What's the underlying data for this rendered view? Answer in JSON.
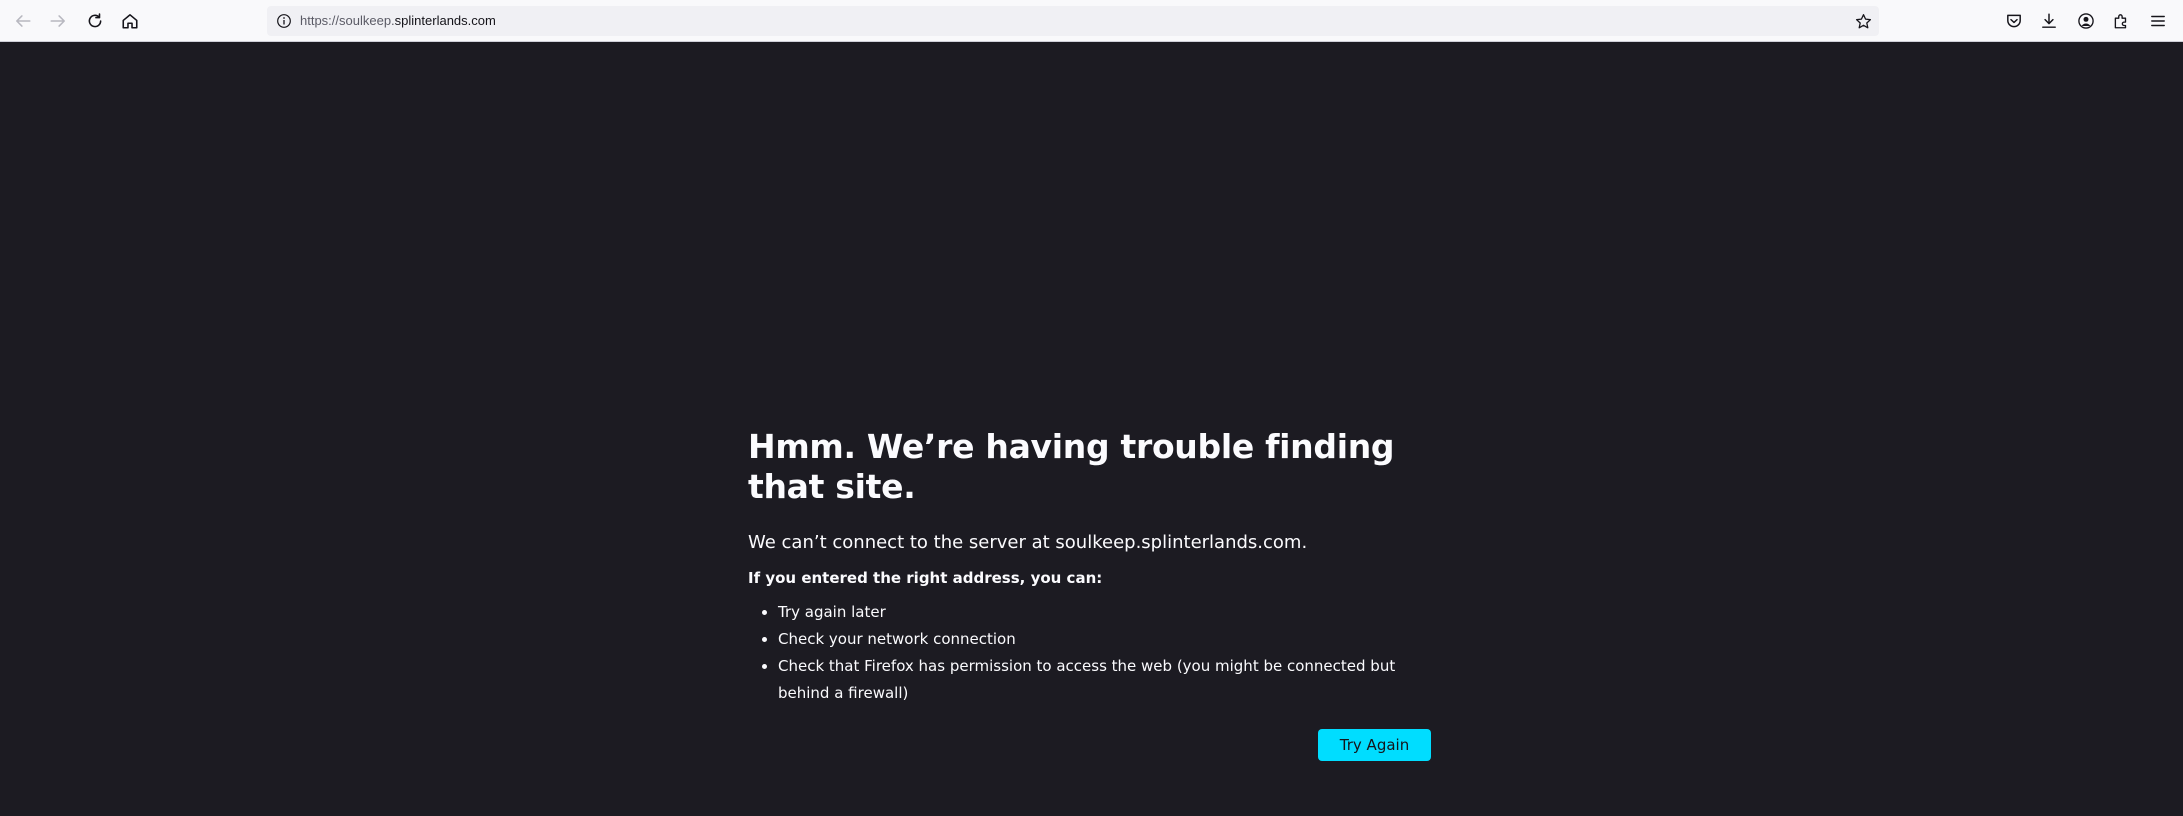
{
  "browser": {
    "nav": {
      "back_icon": "arrow-left-icon",
      "forward_icon": "arrow-right-icon",
      "reload_icon": "reload-icon",
      "home_icon": "home-icon"
    },
    "urlbar": {
      "scheme": "https://soulkeep.",
      "host": "splinterlands.com",
      "info_icon": "info-icon",
      "bookmark_icon": "star-icon"
    },
    "toolbar_right": {
      "icons": [
        "pocket-icon",
        "download-icon",
        "account-icon",
        "extensions-icon",
        "menu-icon"
      ]
    }
  },
  "error_page": {
    "title": "Hmm. We’re having trouble finding that site.",
    "description": "We can’t connect to the server at soulkeep.splinterlands.com.",
    "suggestions_intro": "If you entered the right address, you can:",
    "suggestions": [
      "Try again later",
      "Check your network connection",
      "Check that Firefox has permission to access the web (you might be connected but behind a firewall)"
    ],
    "try_again_label": "Try Again"
  },
  "colors": {
    "page_background": "#1c1b22",
    "text": "#fbfbfe",
    "primary_button": "#00ddff",
    "toolbar": "#f9f9fb",
    "urlbar": "#f0f0f4"
  }
}
